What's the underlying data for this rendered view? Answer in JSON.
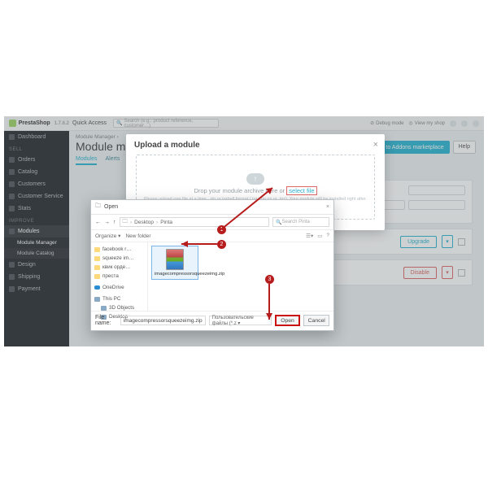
{
  "brand": {
    "name": "PrestaShop",
    "version": "1.7.6.2"
  },
  "topbar": {
    "quick_access": "Quick Access",
    "search_placeholder": "Search (e.g.: product reference, customer…)",
    "debug": "Debug mode",
    "view_shop": "View my shop"
  },
  "sidebar": {
    "dashboard": "Dashboard",
    "sell_label": "SELL",
    "sell": [
      "Orders",
      "Catalog",
      "Customers",
      "Customer Service",
      "Stats"
    ],
    "improve_label": "IMPROVE",
    "modules": "Modules",
    "module_manager": "Module Manager",
    "module_catalog": "Module Catalog",
    "improve_rest": [
      "Design",
      "Shipping",
      "Payment"
    ]
  },
  "page": {
    "breadcrumb": "Module Manager ›",
    "title": "Module manager",
    "connect": "Connect to Addons marketplace",
    "help": "Help",
    "tabs": {
      "modules": "Modules",
      "alerts": "Alerts"
    },
    "upgrade": "Upgrade",
    "disable": "Disable"
  },
  "modal": {
    "title": "Upload a module",
    "drop_text": "Drop your module archive here or",
    "select_file": "select file",
    "hint": "Please upload one file at a time, .zip or tarball format (.tar, .tar.gz or .tgz). Your module will be installed right after."
  },
  "filedlg": {
    "title": "Open",
    "path": [
      "Desktop",
      "Pinta"
    ],
    "search_placeholder": "Search Pinta",
    "organize": "Organize ▾",
    "newfolder": "New folder",
    "tree": {
      "folders": [
        "facebook r…",
        "squeeze im…",
        "квик орде…",
        "преста"
      ],
      "onedrive": "OneDrive",
      "thispc": "This PC",
      "objects3d": "3D Objects",
      "desktop": "Desktop"
    },
    "selected_file": "imagecompressorsqueezeimg.zip",
    "selected_file_wrapped": "imagecompressorsqueezeimg.zip",
    "filename_label": "File name:",
    "filetype": "Пользовательские файлы (*.z ▾",
    "open": "Open",
    "cancel": "Cancel"
  },
  "annot": {
    "s1": "1",
    "s2": "2",
    "s3": "3"
  }
}
